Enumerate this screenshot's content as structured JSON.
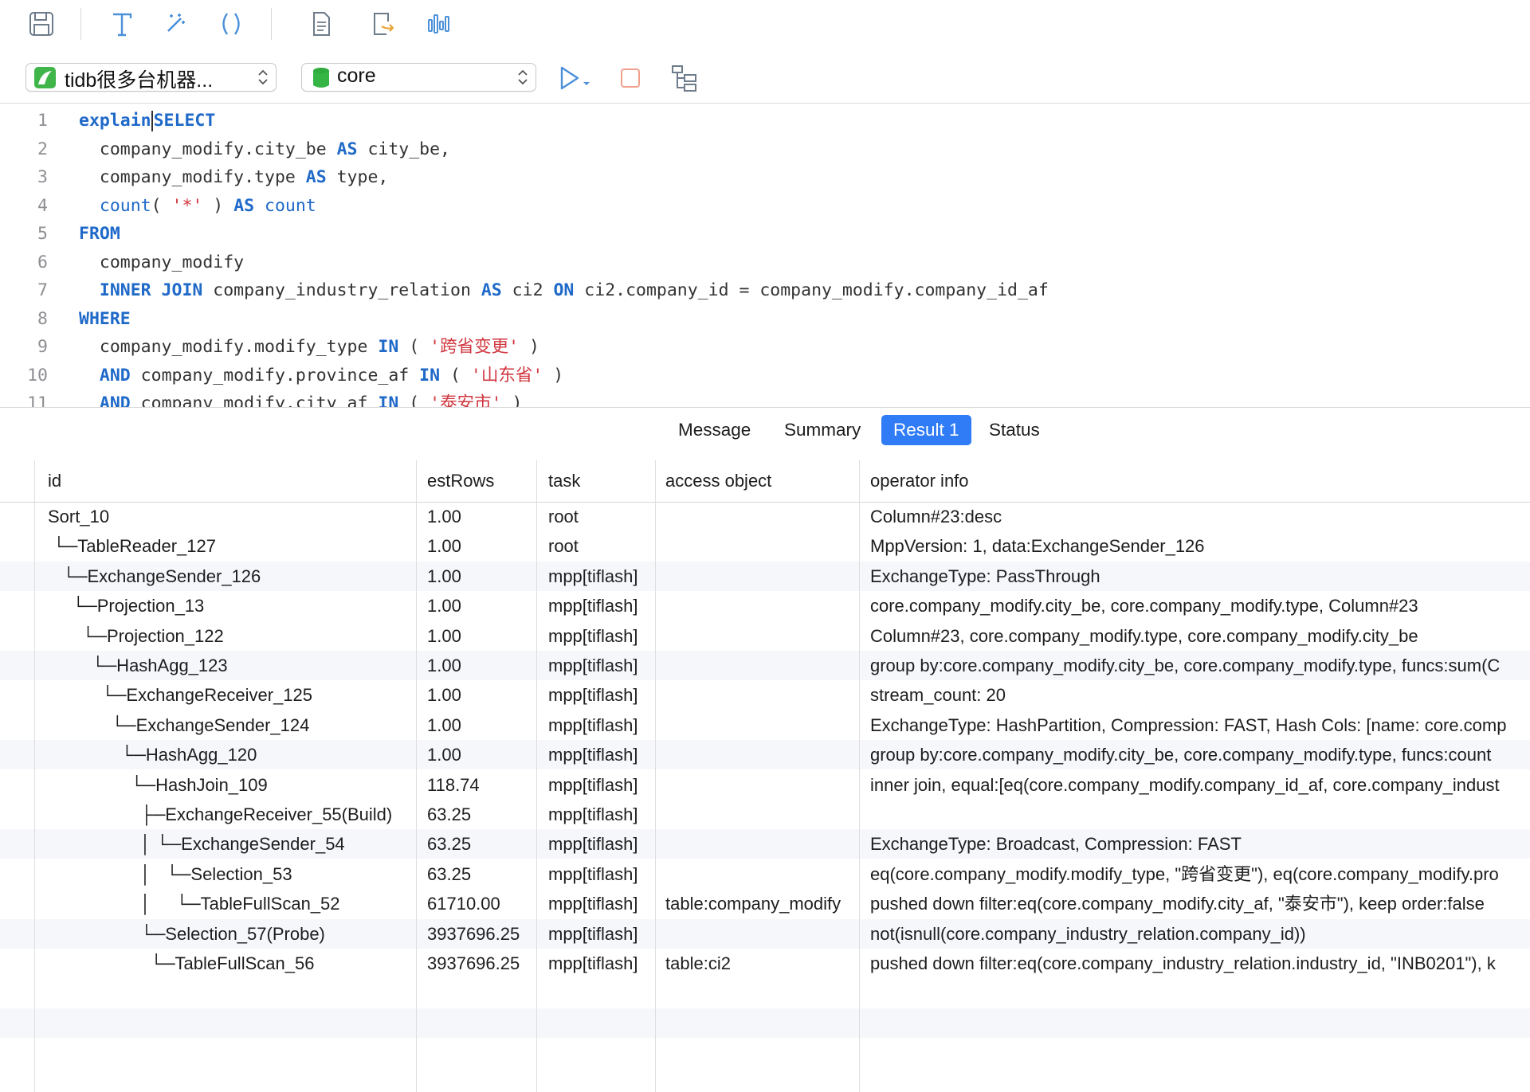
{
  "toolbar": {
    "icons": [
      "save-icon",
      "format-icon",
      "beautify-wand-icon",
      "parentheses-icon",
      "document-icon",
      "export-icon",
      "chart-icon"
    ],
    "connection": {
      "label": "tidb很多台机器..."
    },
    "database": {
      "label": "core"
    },
    "actions": [
      "run-icon",
      "stop-icon",
      "explain-plan-icon"
    ]
  },
  "editor": {
    "lines": [
      {
        "num": "1",
        "tokens": [
          [
            "kw",
            "explain"
          ],
          [
            "cursor",
            ""
          ],
          [
            "kw",
            "SELECT"
          ]
        ]
      },
      {
        "num": "2",
        "tokens": [
          [
            "plain",
            "  company_modify.city_be "
          ],
          [
            "kw",
            "AS"
          ],
          [
            "plain",
            " city_be,"
          ]
        ]
      },
      {
        "num": "3",
        "tokens": [
          [
            "plain",
            "  company_modify.type "
          ],
          [
            "kw",
            "AS"
          ],
          [
            "plain",
            " type,"
          ]
        ]
      },
      {
        "num": "4",
        "tokens": [
          [
            "fn",
            "  count"
          ],
          [
            "plain",
            "( "
          ],
          [
            "str",
            "'*'"
          ],
          [
            "plain",
            " ) "
          ],
          [
            "kw",
            "AS"
          ],
          [
            "fn",
            " count"
          ]
        ]
      },
      {
        "num": "5",
        "tokens": [
          [
            "kw",
            "FROM"
          ]
        ]
      },
      {
        "num": "6",
        "tokens": [
          [
            "plain",
            "  company_modify"
          ]
        ]
      },
      {
        "num": "7",
        "tokens": [
          [
            "kw",
            "  INNER JOIN"
          ],
          [
            "plain",
            " company_industry_relation "
          ],
          [
            "kw",
            "AS"
          ],
          [
            "plain",
            " ci2 "
          ],
          [
            "kw",
            "ON"
          ],
          [
            "plain",
            " ci2.company_id = company_modify.company_id_af"
          ]
        ]
      },
      {
        "num": "8",
        "tokens": [
          [
            "kw",
            "WHERE"
          ]
        ]
      },
      {
        "num": "9",
        "tokens": [
          [
            "plain",
            "  company_modify.modify_type "
          ],
          [
            "kw",
            "IN"
          ],
          [
            "plain",
            " ( "
          ],
          [
            "str",
            "'跨省变更'"
          ],
          [
            "plain",
            " )"
          ]
        ]
      },
      {
        "num": "10",
        "tokens": [
          [
            "kw",
            "  AND"
          ],
          [
            "plain",
            " company_modify.province_af "
          ],
          [
            "kw",
            "IN"
          ],
          [
            "plain",
            " ( "
          ],
          [
            "str",
            "'山东省'"
          ],
          [
            "plain",
            " )"
          ]
        ]
      },
      {
        "num": "11",
        "tokens": [
          [
            "kw",
            "  AND"
          ],
          [
            "plain",
            " company_modify.city_af "
          ],
          [
            "kw",
            "IN"
          ],
          [
            "plain",
            " ( "
          ],
          [
            "str",
            "'泰安市'"
          ],
          [
            "plain",
            " )"
          ]
        ]
      }
    ]
  },
  "tabs": [
    {
      "label": "Message",
      "active": false
    },
    {
      "label": "Summary",
      "active": false
    },
    {
      "label": "Result 1",
      "active": true
    },
    {
      "label": "Status",
      "active": false
    }
  ],
  "grid": {
    "columns": [
      "id",
      "estRows",
      "task",
      "access object",
      "operator info"
    ],
    "rows": [
      {
        "id": "Sort_10",
        "est": "1.00",
        "task": "root",
        "acc": "",
        "op": "Column#23:desc"
      },
      {
        "id": " └─TableReader_127",
        "est": "1.00",
        "task": "root",
        "acc": "",
        "op": "MppVersion: 1, data:ExchangeSender_126"
      },
      {
        "id": "   └─ExchangeSender_126",
        "est": "1.00",
        "task": "mpp[tiflash]",
        "acc": "",
        "op": "ExchangeType: PassThrough"
      },
      {
        "id": "     └─Projection_13",
        "est": "1.00",
        "task": "mpp[tiflash]",
        "acc": "",
        "op": "core.company_modify.city_be, core.company_modify.type, Column#23"
      },
      {
        "id": "       └─Projection_122",
        "est": "1.00",
        "task": "mpp[tiflash]",
        "acc": "",
        "op": "Column#23, core.company_modify.type, core.company_modify.city_be"
      },
      {
        "id": "         └─HashAgg_123",
        "est": "1.00",
        "task": "mpp[tiflash]",
        "acc": "",
        "op": "group by:core.company_modify.city_be, core.company_modify.type, funcs:sum(C"
      },
      {
        "id": "           └─ExchangeReceiver_125",
        "est": "1.00",
        "task": "mpp[tiflash]",
        "acc": "",
        "op": "stream_count: 20"
      },
      {
        "id": "             └─ExchangeSender_124",
        "est": "1.00",
        "task": "mpp[tiflash]",
        "acc": "",
        "op": "ExchangeType: HashPartition, Compression: FAST, Hash Cols: [name: core.comp"
      },
      {
        "id": "               └─HashAgg_120",
        "est": "1.00",
        "task": "mpp[tiflash]",
        "acc": "",
        "op": "group by:core.company_modify.city_be, core.company_modify.type, funcs:count"
      },
      {
        "id": "                 └─HashJoin_109",
        "est": "118.74",
        "task": "mpp[tiflash]",
        "acc": "",
        "op": "inner join, equal:[eq(core.company_modify.company_id_af, core.company_indust"
      },
      {
        "id": "                   ├─ExchangeReceiver_55(Build)",
        "est": "63.25",
        "task": "mpp[tiflash]",
        "acc": "",
        "op": ""
      },
      {
        "id": "                   │ └─ExchangeSender_54",
        "est": "63.25",
        "task": "mpp[tiflash]",
        "acc": "",
        "op": "ExchangeType: Broadcast, Compression: FAST"
      },
      {
        "id": "                   │   └─Selection_53",
        "est": "63.25",
        "task": "mpp[tiflash]",
        "acc": "",
        "op": "eq(core.company_modify.modify_type, \"跨省变更\"), eq(core.company_modify.pro"
      },
      {
        "id": "                   │     └─TableFullScan_52",
        "est": "61710.00",
        "task": "mpp[tiflash]",
        "acc": "table:company_modify",
        "op": "pushed down filter:eq(core.company_modify.city_af, \"泰安市\"), keep order:false"
      },
      {
        "id": "                   └─Selection_57(Probe)",
        "est": "3937696.25",
        "task": "mpp[tiflash]",
        "acc": "",
        "op": "not(isnull(core.company_industry_relation.company_id))"
      },
      {
        "id": "                     └─TableFullScan_56",
        "est": "3937696.25",
        "task": "mpp[tiflash]",
        "acc": "table:ci2",
        "op": "pushed down filter:eq(core.company_industry_relation.industry_id, \"INB0201\"), k"
      }
    ]
  }
}
